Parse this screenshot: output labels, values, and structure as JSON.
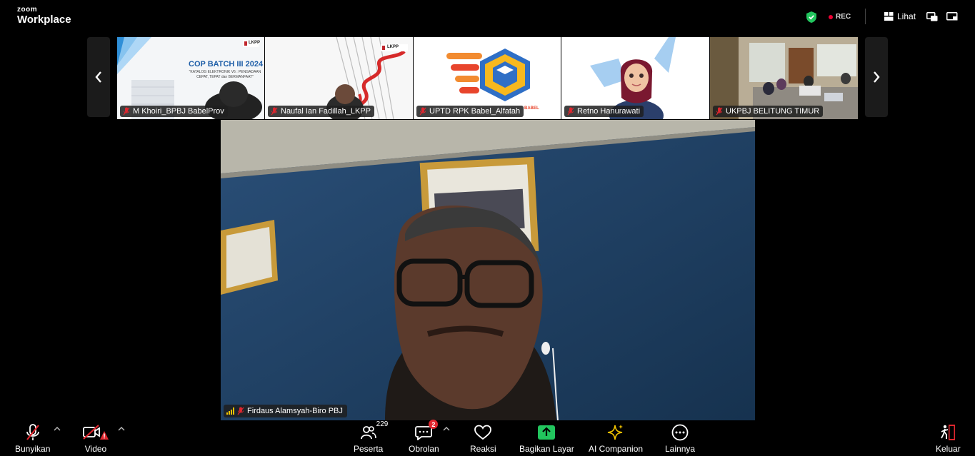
{
  "app": {
    "logo_small": "zoom",
    "logo_big": "Workplace"
  },
  "topbar": {
    "rec_label": "REC",
    "view_label": "Lihat",
    "shield_color": "#22c55e",
    "rec_color": "#e0262e"
  },
  "thumbnails": [
    {
      "name": "M Khoiri_BPBJ BabelProv",
      "slide_title": "COP BATCH III 2024",
      "slide_sub": "\"KATALOG ELEKTRONIK V6 : PENGADAAN CEPAT, TEPAT dan BERMANFAAT\"",
      "logo": "LKPP"
    },
    {
      "name": "Naufal Ian Fadillah_LKPP",
      "logo": "LKPP"
    },
    {
      "name": "UPTD RPK Babel_Alfatah",
      "tag": "BABEL"
    },
    {
      "name": "Retno Hanurawati"
    },
    {
      "name": "UKPBJ BELITUNG TIMUR"
    }
  ],
  "main_speaker": {
    "name": "Firdaus Alamsyah-Biro PBJ"
  },
  "toolbar": {
    "mute_label": "Bunyikan",
    "video_label": "Video",
    "participants_label": "Peserta",
    "participants_count": "229",
    "chat_label": "Obrolan",
    "chat_badge": "2",
    "reactions_label": "Reaksi",
    "share_label": "Bagikan Layar",
    "ai_label": "AI Companion",
    "more_label": "Lainnya",
    "leave_label": "Keluar",
    "share_color": "#22c55e",
    "ai_color": "#f2c400"
  }
}
